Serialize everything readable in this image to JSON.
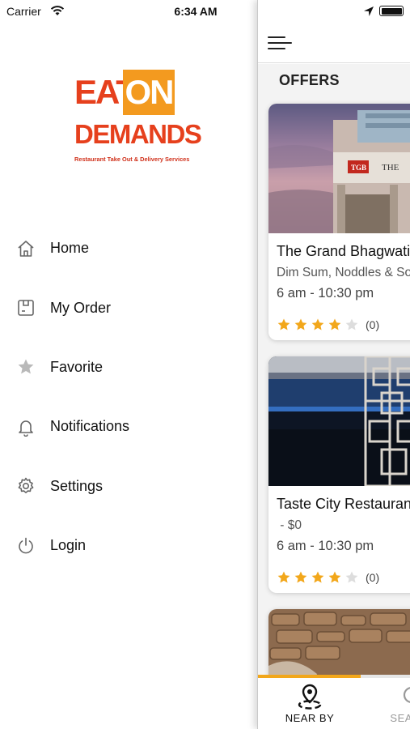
{
  "status_bar": {
    "carrier": "Carrier",
    "time": "6:34 AM"
  },
  "drawer": {
    "logo": {
      "line1_left": "EAT",
      "line1_right": "ON",
      "line2": "DEMANDS",
      "tagline": "Restaurant Take Out & Delivery Services"
    },
    "menu": [
      {
        "label": "Home",
        "icon": "home-icon"
      },
      {
        "label": "My Order",
        "icon": "order-icon"
      },
      {
        "label": "Favorite",
        "icon": "star-icon"
      },
      {
        "label": "Notifications",
        "icon": "bell-icon"
      },
      {
        "label": "Settings",
        "icon": "gear-icon"
      },
      {
        "label": "Login",
        "icon": "power-icon"
      }
    ]
  },
  "main": {
    "section_title": "OFFERS",
    "cards": [
      {
        "name": "The Grand Bhagwati",
        "cuisine": "Dim Sum, Noddles & Soups",
        "hours": "6 am - 10:30 pm",
        "rating": 4,
        "max_rating": 5,
        "rating_count": "(0)",
        "image_sign": "THE"
      },
      {
        "name": "Taste City Restaurant",
        "cuisine": " - $0",
        "hours": "6 am - 10:30 pm",
        "rating": 4,
        "max_rating": 5,
        "rating_count": "(0)"
      }
    ],
    "scroll_progress": 0.67,
    "tabs": [
      {
        "label": "NEAR BY",
        "icon": "location-pin-icon",
        "active": true
      },
      {
        "label": "SEARCH",
        "icon": "search-icon",
        "active": false
      }
    ]
  },
  "colors": {
    "accent": "#f2a71b",
    "star_filled": "#f2a71b",
    "star_empty": "#dddddd"
  }
}
